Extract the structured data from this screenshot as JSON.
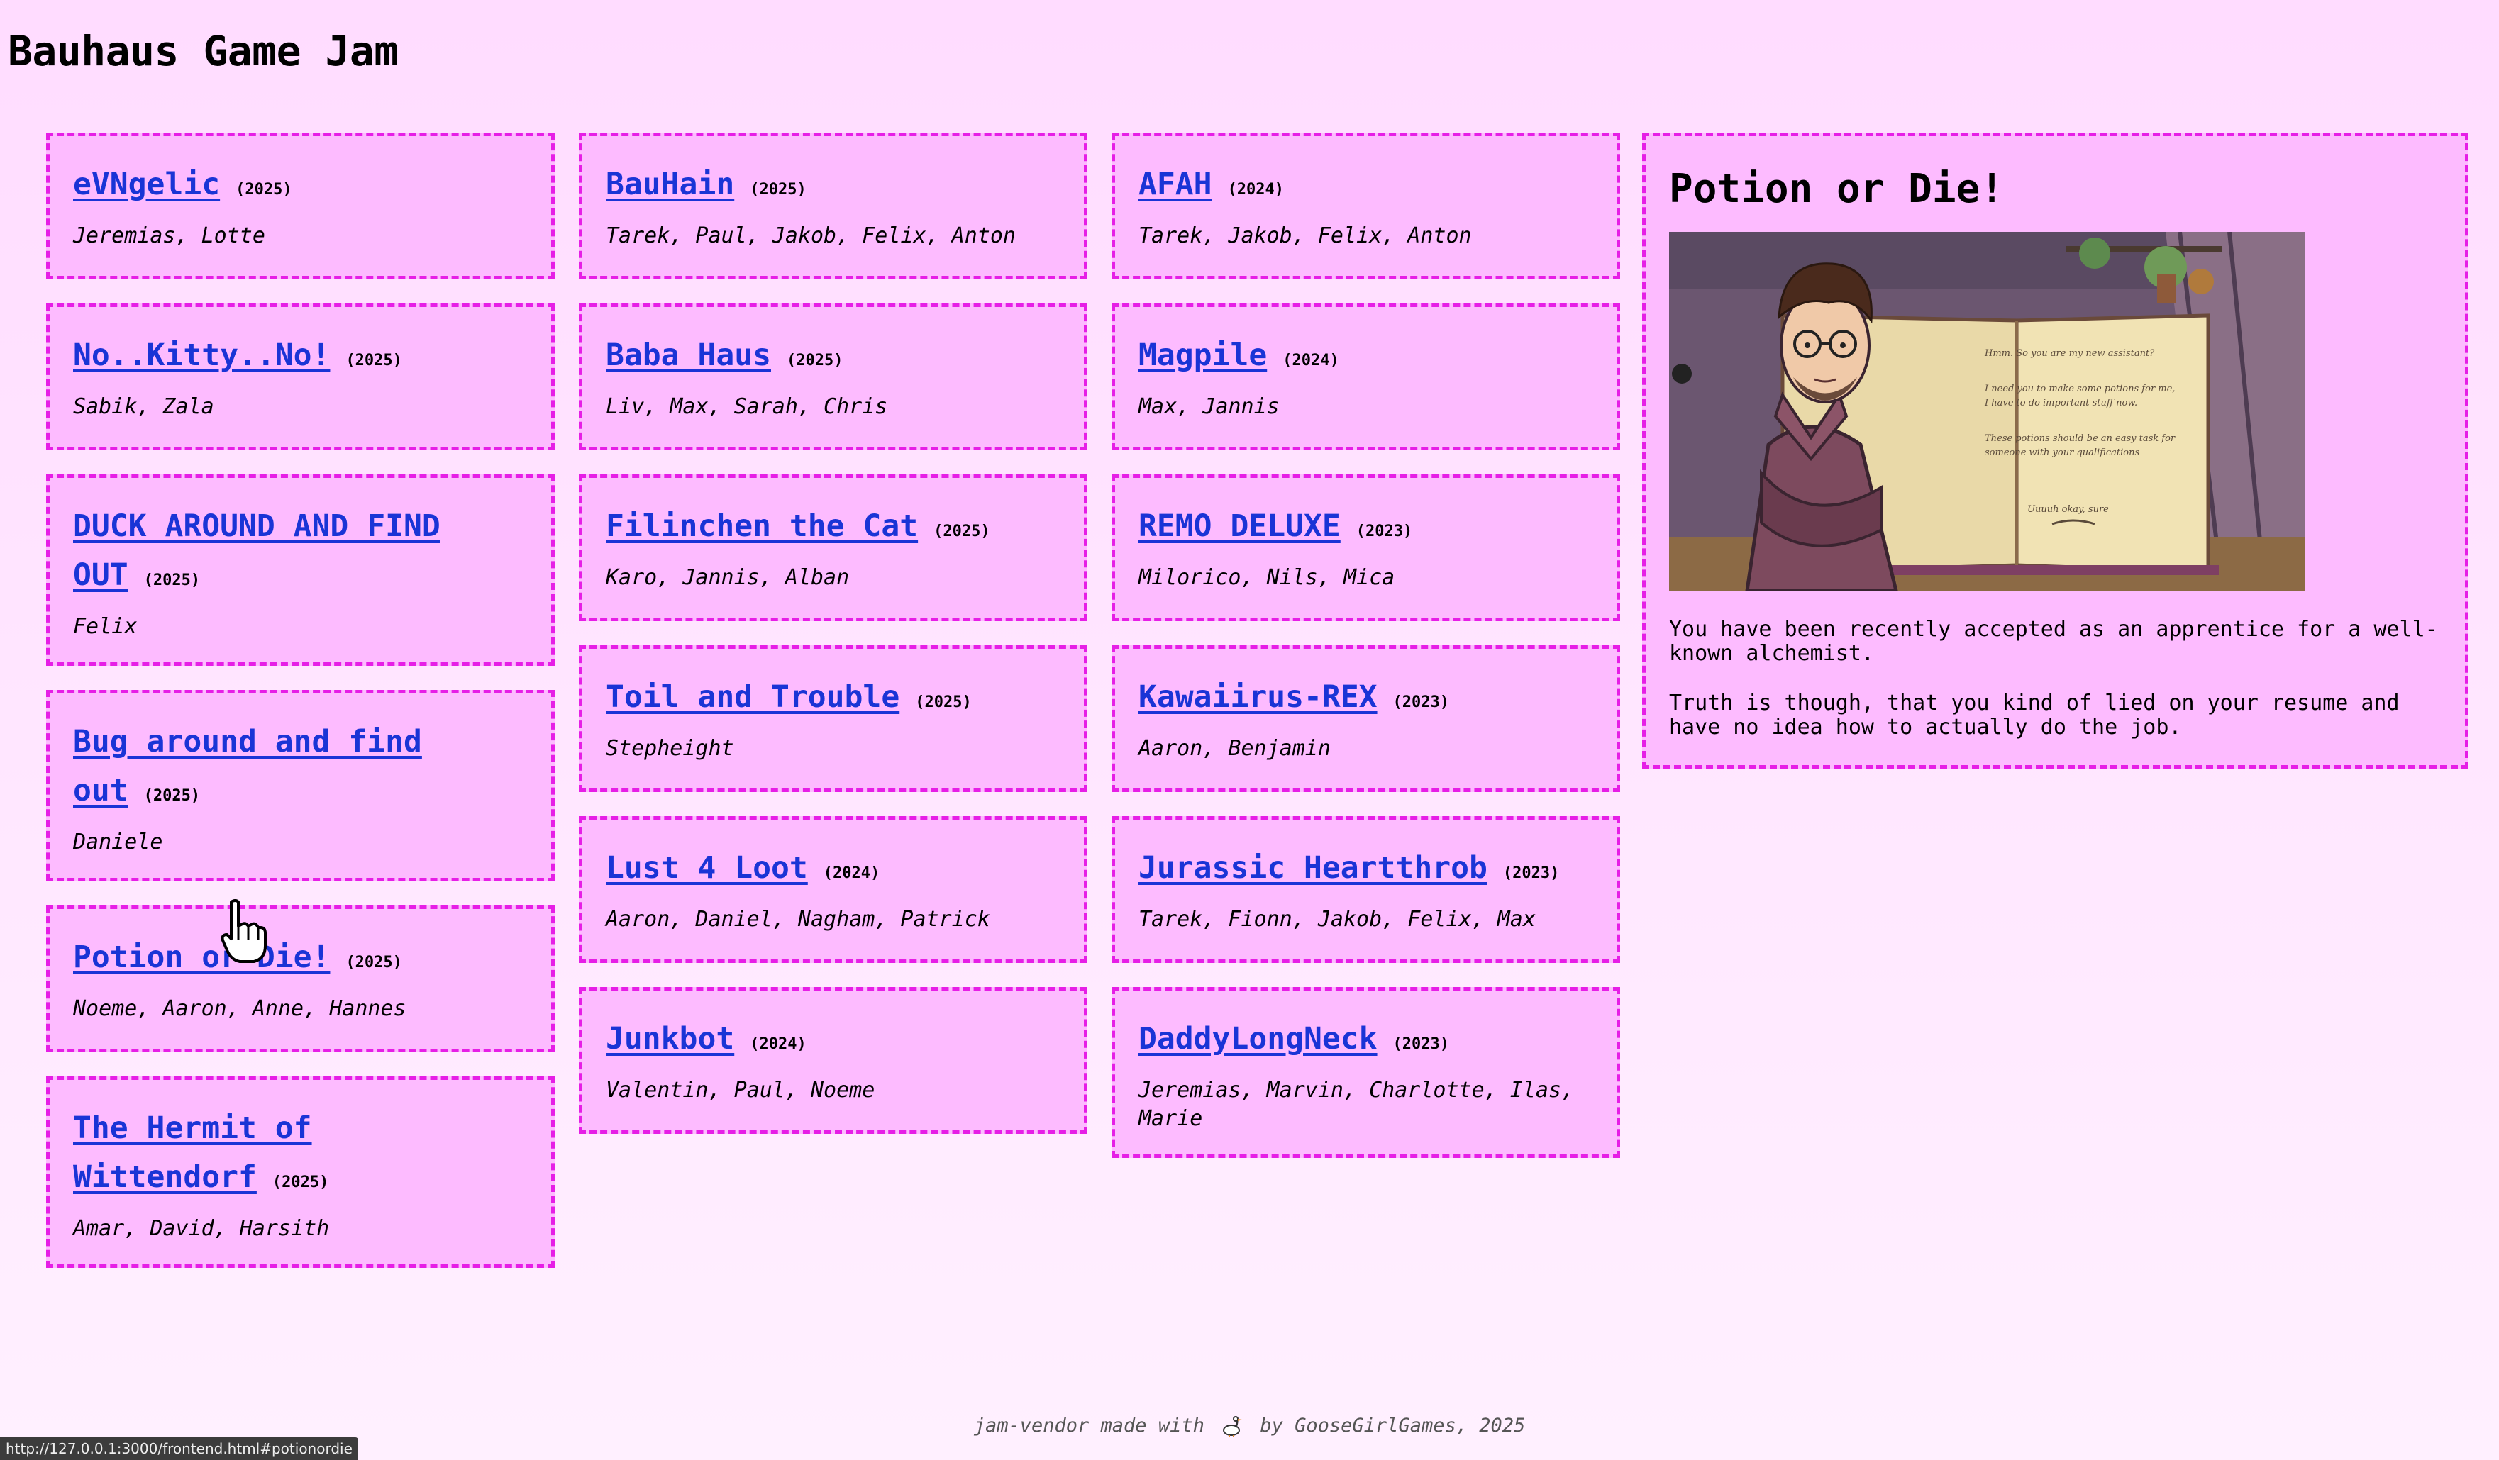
{
  "page": {
    "title": "Bauhaus Game Jam"
  },
  "colors": {
    "background": "#ffdcff",
    "card_bg": "#fdbbff",
    "card_border": "#e61ee6",
    "link": "#1a34d6"
  },
  "games": {
    "col1": [
      {
        "title": "eVNgelic",
        "year": "(2025)",
        "authors": "Jeremias, Lotte"
      },
      {
        "title": "No..Kitty..No!",
        "year": "(2025)",
        "authors": "Sabik, Zala"
      },
      {
        "title": "DUCK AROUND AND FIND OUT",
        "year": "(2025)",
        "authors": "Felix"
      },
      {
        "title": "Bug around and find out",
        "year": "(2025)",
        "authors": "Daniele"
      },
      {
        "title": "Potion or Die!",
        "year": "(2025)",
        "authors": "Noeme, Aaron, Anne, Hannes"
      },
      {
        "title": "The Hermit of Wittendorf",
        "year": "(2025)",
        "authors": "Amar, David, Harsith"
      }
    ],
    "col2": [
      {
        "title": "BauHain",
        "year": "(2025)",
        "authors": "Tarek, Paul, Jakob, Felix, Anton"
      },
      {
        "title": "Baba Haus",
        "year": "(2025)",
        "authors": "Liv, Max, Sarah, Chris"
      },
      {
        "title": "Filinchen the Cat",
        "year": "(2025)",
        "authors": "Karo, Jannis, Alban"
      },
      {
        "title": "Toil and Trouble",
        "year": "(2025)",
        "authors": "Stepheight"
      },
      {
        "title": "Lust 4 Loot",
        "year": "(2024)",
        "authors": "Aaron, Daniel, Nagham, Patrick"
      },
      {
        "title": "Junkbot",
        "year": "(2024)",
        "authors": "Valentin, Paul, Noeme"
      }
    ],
    "col3": [
      {
        "title": "AFAH",
        "year": "(2024)",
        "authors": "Tarek, Jakob, Felix, Anton"
      },
      {
        "title": "Magpile",
        "year": "(2024)",
        "authors": "Max, Jannis"
      },
      {
        "title": "REMO DELUXE",
        "year": "(2023)",
        "authors": "Milorico, Nils, Mica"
      },
      {
        "title": "Kawaiirus-REX",
        "year": "(2023)",
        "authors": "Aaron, Benjamin"
      },
      {
        "title": "Jurassic Heartthrob",
        "year": "(2023)",
        "authors": "Tarek, Fionn, Jakob, Felix, Max"
      },
      {
        "title": "DaddyLongNeck",
        "year": "(2023)",
        "authors": "Jeremias, Marvin, Charlotte, Ilas, Marie"
      }
    ]
  },
  "detail": {
    "title": "Potion or Die!",
    "screenshot_icon": "game-screenshot",
    "book_text": {
      "line1": "Hmm. So you are my new assistant?",
      "line2": "I need you to make some potions for me,",
      "line3": "I have to do important stuff now.",
      "line4": "These potions should be an easy task for",
      "line5": "someone with your qualifications",
      "reply": "Uuuuh okay, sure"
    },
    "paragraphs": [
      "You have been recently accepted as an apprentice for a well-known alchemist.",
      "Truth is though, that you kind of lied on your resume and have no idea how to actually do the job."
    ]
  },
  "footer": {
    "before": "jam-vendor made with",
    "after": "by GooseGirlGames, 2025",
    "icon": "goose-icon"
  },
  "status_url": "http://127.0.0.1:3000/frontend.html#potionordie",
  "cursor_icon": "hand-pointer-icon"
}
